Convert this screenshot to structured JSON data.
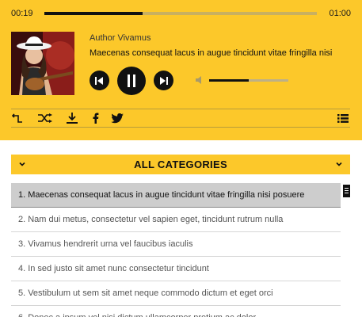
{
  "player": {
    "time_current": "00:19",
    "time_total": "01:00",
    "progress_fraction": 0.36,
    "volume_fraction": 0.5,
    "author": "Author Vivamus",
    "title": "Maecenas consequat lacus in augue tincidunt vitae fringilla nisi"
  },
  "toolbar": {
    "icons": [
      "return-icon",
      "shuffle-icon",
      "download-icon",
      "facebook-icon",
      "twitter-icon",
      "playlist-icon"
    ]
  },
  "categories": {
    "label": "ALL CATEGORIES"
  },
  "playlist": {
    "items": [
      {
        "num": "1.",
        "text": "Maecenas consequat lacus in augue tincidunt vitae fringilla nisi posuere"
      },
      {
        "num": "2.",
        "text": "Nam dui metus, consectetur vel sapien eget, tincidunt rutrum nulla"
      },
      {
        "num": "3.",
        "text": "Vivamus hendrerit urna vel faucibus iaculis"
      },
      {
        "num": "4.",
        "text": "In sed justo sit amet nunc consectetur tincidunt"
      },
      {
        "num": "5.",
        "text": "Vestibulum ut sem sit amet neque commodo dictum et eget orci"
      },
      {
        "num": "6.",
        "text": "Donec a ipsum vel nisi dictum ullamcorper pretium ac dolor"
      }
    ],
    "active_index": 0
  },
  "colors": {
    "accent": "#fcc82a",
    "dark": "#111111"
  }
}
